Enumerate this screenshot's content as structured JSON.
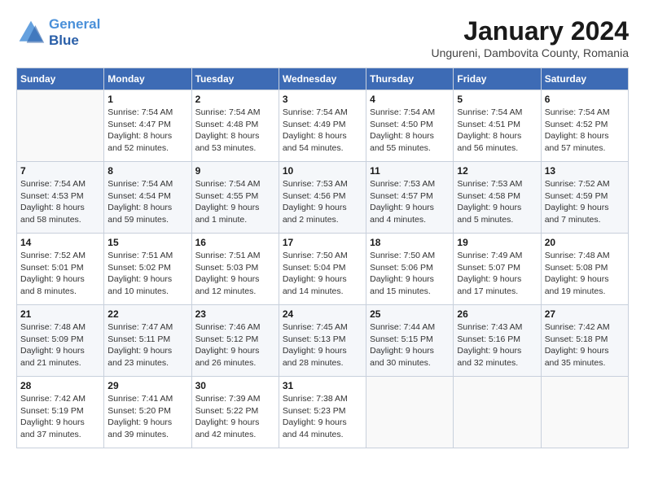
{
  "header": {
    "logo_line1": "General",
    "logo_line2": "Blue",
    "month_title": "January 2024",
    "location": "Ungureni, Dambovita County, Romania"
  },
  "days_of_week": [
    "Sunday",
    "Monday",
    "Tuesday",
    "Wednesday",
    "Thursday",
    "Friday",
    "Saturday"
  ],
  "weeks": [
    [
      {
        "day": "",
        "info": ""
      },
      {
        "day": "1",
        "info": "Sunrise: 7:54 AM\nSunset: 4:47 PM\nDaylight: 8 hours\nand 52 minutes."
      },
      {
        "day": "2",
        "info": "Sunrise: 7:54 AM\nSunset: 4:48 PM\nDaylight: 8 hours\nand 53 minutes."
      },
      {
        "day": "3",
        "info": "Sunrise: 7:54 AM\nSunset: 4:49 PM\nDaylight: 8 hours\nand 54 minutes."
      },
      {
        "day": "4",
        "info": "Sunrise: 7:54 AM\nSunset: 4:50 PM\nDaylight: 8 hours\nand 55 minutes."
      },
      {
        "day": "5",
        "info": "Sunrise: 7:54 AM\nSunset: 4:51 PM\nDaylight: 8 hours\nand 56 minutes."
      },
      {
        "day": "6",
        "info": "Sunrise: 7:54 AM\nSunset: 4:52 PM\nDaylight: 8 hours\nand 57 minutes."
      }
    ],
    [
      {
        "day": "7",
        "info": "Sunrise: 7:54 AM\nSunset: 4:53 PM\nDaylight: 8 hours\nand 58 minutes."
      },
      {
        "day": "8",
        "info": "Sunrise: 7:54 AM\nSunset: 4:54 PM\nDaylight: 8 hours\nand 59 minutes."
      },
      {
        "day": "9",
        "info": "Sunrise: 7:54 AM\nSunset: 4:55 PM\nDaylight: 9 hours\nand 1 minute."
      },
      {
        "day": "10",
        "info": "Sunrise: 7:53 AM\nSunset: 4:56 PM\nDaylight: 9 hours\nand 2 minutes."
      },
      {
        "day": "11",
        "info": "Sunrise: 7:53 AM\nSunset: 4:57 PM\nDaylight: 9 hours\nand 4 minutes."
      },
      {
        "day": "12",
        "info": "Sunrise: 7:53 AM\nSunset: 4:58 PM\nDaylight: 9 hours\nand 5 minutes."
      },
      {
        "day": "13",
        "info": "Sunrise: 7:52 AM\nSunset: 4:59 PM\nDaylight: 9 hours\nand 7 minutes."
      }
    ],
    [
      {
        "day": "14",
        "info": "Sunrise: 7:52 AM\nSunset: 5:01 PM\nDaylight: 9 hours\nand 8 minutes."
      },
      {
        "day": "15",
        "info": "Sunrise: 7:51 AM\nSunset: 5:02 PM\nDaylight: 9 hours\nand 10 minutes."
      },
      {
        "day": "16",
        "info": "Sunrise: 7:51 AM\nSunset: 5:03 PM\nDaylight: 9 hours\nand 12 minutes."
      },
      {
        "day": "17",
        "info": "Sunrise: 7:50 AM\nSunset: 5:04 PM\nDaylight: 9 hours\nand 14 minutes."
      },
      {
        "day": "18",
        "info": "Sunrise: 7:50 AM\nSunset: 5:06 PM\nDaylight: 9 hours\nand 15 minutes."
      },
      {
        "day": "19",
        "info": "Sunrise: 7:49 AM\nSunset: 5:07 PM\nDaylight: 9 hours\nand 17 minutes."
      },
      {
        "day": "20",
        "info": "Sunrise: 7:48 AM\nSunset: 5:08 PM\nDaylight: 9 hours\nand 19 minutes."
      }
    ],
    [
      {
        "day": "21",
        "info": "Sunrise: 7:48 AM\nSunset: 5:09 PM\nDaylight: 9 hours\nand 21 minutes."
      },
      {
        "day": "22",
        "info": "Sunrise: 7:47 AM\nSunset: 5:11 PM\nDaylight: 9 hours\nand 23 minutes."
      },
      {
        "day": "23",
        "info": "Sunrise: 7:46 AM\nSunset: 5:12 PM\nDaylight: 9 hours\nand 26 minutes."
      },
      {
        "day": "24",
        "info": "Sunrise: 7:45 AM\nSunset: 5:13 PM\nDaylight: 9 hours\nand 28 minutes."
      },
      {
        "day": "25",
        "info": "Sunrise: 7:44 AM\nSunset: 5:15 PM\nDaylight: 9 hours\nand 30 minutes."
      },
      {
        "day": "26",
        "info": "Sunrise: 7:43 AM\nSunset: 5:16 PM\nDaylight: 9 hours\nand 32 minutes."
      },
      {
        "day": "27",
        "info": "Sunrise: 7:42 AM\nSunset: 5:18 PM\nDaylight: 9 hours\nand 35 minutes."
      }
    ],
    [
      {
        "day": "28",
        "info": "Sunrise: 7:42 AM\nSunset: 5:19 PM\nDaylight: 9 hours\nand 37 minutes."
      },
      {
        "day": "29",
        "info": "Sunrise: 7:41 AM\nSunset: 5:20 PM\nDaylight: 9 hours\nand 39 minutes."
      },
      {
        "day": "30",
        "info": "Sunrise: 7:39 AM\nSunset: 5:22 PM\nDaylight: 9 hours\nand 42 minutes."
      },
      {
        "day": "31",
        "info": "Sunrise: 7:38 AM\nSunset: 5:23 PM\nDaylight: 9 hours\nand 44 minutes."
      },
      {
        "day": "",
        "info": ""
      },
      {
        "day": "",
        "info": ""
      },
      {
        "day": "",
        "info": ""
      }
    ]
  ]
}
